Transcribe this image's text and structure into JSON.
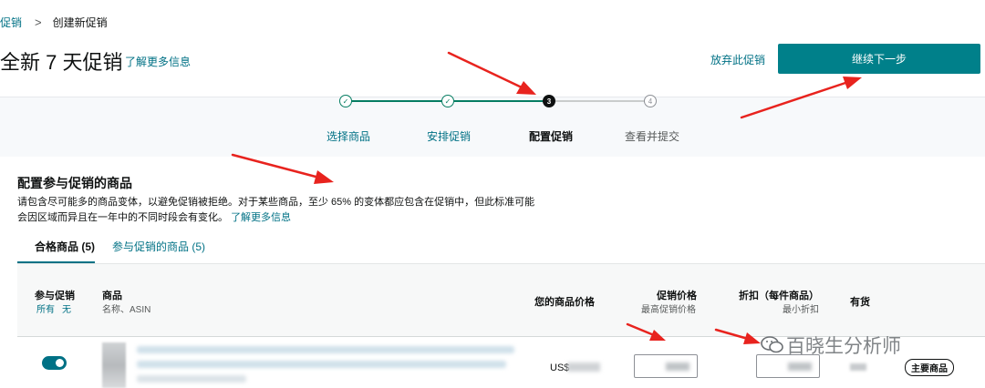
{
  "breadcrumb": {
    "parent": "促销",
    "separator": ">",
    "current": "创建新促销"
  },
  "header": {
    "title": "全新 7 天促销",
    "learn_more": "了解更多信息",
    "abandon": "放弃此促销",
    "continue": "继续下一步"
  },
  "stepper": {
    "steps": [
      {
        "label": "选择商品",
        "marker": "✓",
        "state": "done"
      },
      {
        "label": "安排促销",
        "marker": "✓",
        "state": "done"
      },
      {
        "label": "配置促销",
        "marker": "3",
        "state": "current"
      },
      {
        "label": "查看并提交",
        "marker": "4",
        "state": "todo"
      }
    ]
  },
  "section": {
    "title": "配置参与促销的商品",
    "description_line1": "请包含尽可能多的商品变体，以避免促销被拒绝。对于某些商品，至少 65% 的变体都应包含在促销中，但此标准可能",
    "description_line2": "会因区域而异且在一年中的不同时段会有变化。",
    "learn_more": "了解更多信息"
  },
  "tabs": [
    {
      "label": "合格商品 (5)",
      "active": true
    },
    {
      "label": "参与促销的商品 (5)",
      "active": false
    }
  ],
  "table": {
    "columns": {
      "participate": "参与促销",
      "participate_all": "所有",
      "participate_none": "无",
      "product": "商品",
      "product_sub": "名称、ASIN",
      "your_price": "您的商品价格",
      "promo_price": "促销价格",
      "promo_price_sub": "最高促销价格",
      "discount": "折扣（每件商品）",
      "discount_sub": "最小折扣",
      "stock": "有货"
    },
    "rows": [
      {
        "participating": true,
        "price_prefix": "US$",
        "badge": "主要商品"
      }
    ]
  },
  "watermark": "百晓生分析师",
  "colors": {
    "accent": "#007185",
    "primary_button": "#00808a",
    "annotation_arrow": "#e8231e",
    "step_done": "#067d62"
  }
}
